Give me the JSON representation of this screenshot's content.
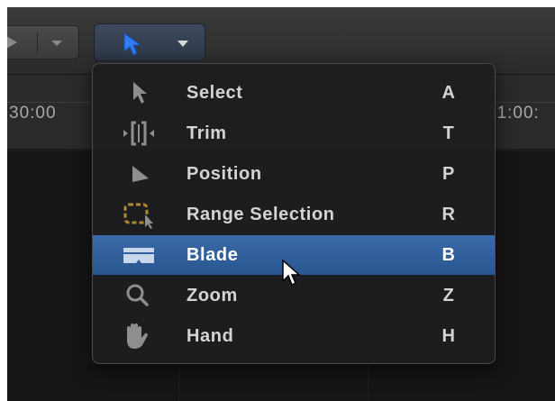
{
  "toolbar": {
    "tool_button_icon": "arrow-pointer-icon",
    "accent": "#2f7cf6"
  },
  "timeline": {
    "time_left": "30:00",
    "time_right": "01:00:"
  },
  "tools_menu": {
    "items": [
      {
        "label": "Select",
        "shortcut": "A",
        "icon": "arrow-select-icon"
      },
      {
        "label": "Trim",
        "shortcut": "T",
        "icon": "trim-icon"
      },
      {
        "label": "Position",
        "shortcut": "P",
        "icon": "position-icon"
      },
      {
        "label": "Range Selection",
        "shortcut": "R",
        "icon": "range-selection-icon"
      },
      {
        "label": "Blade",
        "shortcut": "B",
        "icon": "blade-icon",
        "highlighted": true
      },
      {
        "label": "Zoom",
        "shortcut": "Z",
        "icon": "zoom-icon"
      },
      {
        "label": "Hand",
        "shortcut": "H",
        "icon": "hand-icon"
      }
    ],
    "highlight_color": "#2f5f9c"
  }
}
